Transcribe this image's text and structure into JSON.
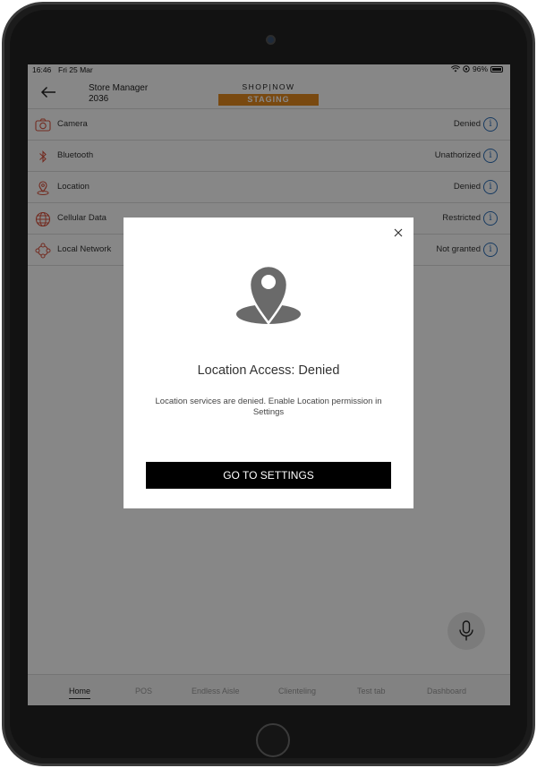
{
  "status_bar": {
    "time": "16:46",
    "date": "Fri 25 Mar",
    "battery": "96%"
  },
  "header": {
    "store_name": "Store Manager",
    "store_id": "2036",
    "brand": "SHOP|NOW",
    "environment": "STAGING"
  },
  "permissions": [
    {
      "label": "Camera",
      "status": "Denied",
      "icon": "camera-icon"
    },
    {
      "label": "Bluetooth",
      "status": "Unathorized",
      "icon": "bluetooth-icon"
    },
    {
      "label": "Location",
      "status": "Denied",
      "icon": "location-pin-icon"
    },
    {
      "label": "Cellular Data",
      "status": "Restricted",
      "icon": "globe-icon"
    },
    {
      "label": "Local Network",
      "status": "Not granted",
      "icon": "network-icon"
    }
  ],
  "info_glyph": "i",
  "modal": {
    "title": "Location Access: Denied",
    "message": "Location services are denied. Enable Location permission in Settings",
    "button_label": "GO TO SETTINGS",
    "icon": "location-pin-icon"
  },
  "tabs": [
    {
      "label": "Home",
      "active": true
    },
    {
      "label": "POS",
      "active": false
    },
    {
      "label": "Endless Aisle",
      "active": false
    },
    {
      "label": "Clienteling",
      "active": false
    },
    {
      "label": "Test tab",
      "active": false
    },
    {
      "label": "Dashboard",
      "active": false
    }
  ],
  "colors": {
    "accent_orange": "#e58a1f",
    "permission_icon_red": "#d9533f",
    "info_blue": "#2d6fb8",
    "overlay": "rgba(0,0,0,0.47)",
    "button_black": "#000000"
  }
}
